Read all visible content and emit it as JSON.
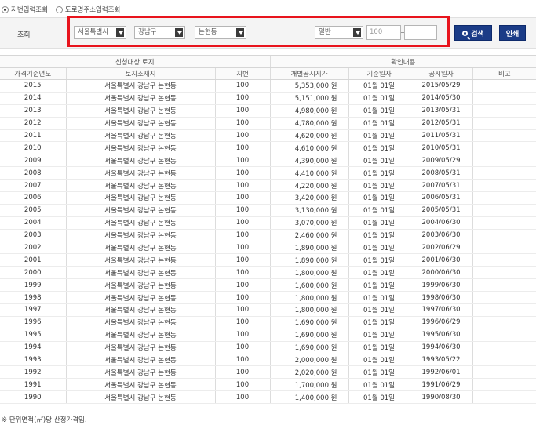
{
  "search_mode": {
    "options": [
      {
        "label": "지번입력조회",
        "checked": true
      },
      {
        "label": "도로명주소입력조회",
        "checked": false
      }
    ]
  },
  "search": {
    "label": "조회",
    "sido": "서울특별시",
    "sigungu": "강남구",
    "dong": "논현동",
    "land_type": "일반",
    "main_number": "100",
    "sub_number": "",
    "search_button": "검색",
    "print_button": "인쇄"
  },
  "table": {
    "group_headers": {
      "target_land": "신청대상 토지",
      "confirm": "확인내용"
    },
    "columns": [
      "가격기준년도",
      "토지소재지",
      "지번",
      "개별공시지가",
      "기준일자",
      "공시일자",
      "비고"
    ],
    "rows": [
      {
        "year": "2015",
        "location": "서울특별시 강남구 논현동",
        "lot": "100",
        "price": "5,353,000 원",
        "base_date": "01월 01일",
        "pub_date": "2015/05/29",
        "note": ""
      },
      {
        "year": "2014",
        "location": "서울특별시 강남구 논현동",
        "lot": "100",
        "price": "5,151,000 원",
        "base_date": "01월 01일",
        "pub_date": "2014/05/30",
        "note": ""
      },
      {
        "year": "2013",
        "location": "서울특별시 강남구 논현동",
        "lot": "100",
        "price": "4,980,000 원",
        "base_date": "01월 01일",
        "pub_date": "2013/05/31",
        "note": ""
      },
      {
        "year": "2012",
        "location": "서울특별시 강남구 논현동",
        "lot": "100",
        "price": "4,780,000 원",
        "base_date": "01월 01일",
        "pub_date": "2012/05/31",
        "note": ""
      },
      {
        "year": "2011",
        "location": "서울특별시 강남구 논현동",
        "lot": "100",
        "price": "4,620,000 원",
        "base_date": "01월 01일",
        "pub_date": "2011/05/31",
        "note": ""
      },
      {
        "year": "2010",
        "location": "서울특별시 강남구 논현동",
        "lot": "100",
        "price": "4,610,000 원",
        "base_date": "01월 01일",
        "pub_date": "2010/05/31",
        "note": ""
      },
      {
        "year": "2009",
        "location": "서울특별시 강남구 논현동",
        "lot": "100",
        "price": "4,390,000 원",
        "base_date": "01월 01일",
        "pub_date": "2009/05/29",
        "note": ""
      },
      {
        "year": "2008",
        "location": "서울특별시 강남구 논현동",
        "lot": "100",
        "price": "4,410,000 원",
        "base_date": "01월 01일",
        "pub_date": "2008/05/31",
        "note": ""
      },
      {
        "year": "2007",
        "location": "서울특별시 강남구 논현동",
        "lot": "100",
        "price": "4,220,000 원",
        "base_date": "01월 01일",
        "pub_date": "2007/05/31",
        "note": ""
      },
      {
        "year": "2006",
        "location": "서울특별시 강남구 논현동",
        "lot": "100",
        "price": "3,420,000 원",
        "base_date": "01월 01일",
        "pub_date": "2006/05/31",
        "note": ""
      },
      {
        "year": "2005",
        "location": "서울특별시 강남구 논현동",
        "lot": "100",
        "price": "3,130,000 원",
        "base_date": "01월 01일",
        "pub_date": "2005/05/31",
        "note": ""
      },
      {
        "year": "2004",
        "location": "서울특별시 강남구 논현동",
        "lot": "100",
        "price": "3,070,000 원",
        "base_date": "01월 01일",
        "pub_date": "2004/06/30",
        "note": ""
      },
      {
        "year": "2003",
        "location": "서울특별시 강남구 논현동",
        "lot": "100",
        "price": "2,460,000 원",
        "base_date": "01월 01일",
        "pub_date": "2003/06/30",
        "note": ""
      },
      {
        "year": "2002",
        "location": "서울특별시 강남구 논현동",
        "lot": "100",
        "price": "1,890,000 원",
        "base_date": "01월 01일",
        "pub_date": "2002/06/29",
        "note": ""
      },
      {
        "year": "2001",
        "location": "서울특별시 강남구 논현동",
        "lot": "100",
        "price": "1,890,000 원",
        "base_date": "01월 01일",
        "pub_date": "2001/06/30",
        "note": ""
      },
      {
        "year": "2000",
        "location": "서울특별시 강남구 논현동",
        "lot": "100",
        "price": "1,800,000 원",
        "base_date": "01월 01일",
        "pub_date": "2000/06/30",
        "note": ""
      },
      {
        "year": "1999",
        "location": "서울특별시 강남구 논현동",
        "lot": "100",
        "price": "1,600,000 원",
        "base_date": "01월 01일",
        "pub_date": "1999/06/30",
        "note": ""
      },
      {
        "year": "1998",
        "location": "서울특별시 강남구 논현동",
        "lot": "100",
        "price": "1,800,000 원",
        "base_date": "01월 01일",
        "pub_date": "1998/06/30",
        "note": ""
      },
      {
        "year": "1997",
        "location": "서울특별시 강남구 논현동",
        "lot": "100",
        "price": "1,800,000 원",
        "base_date": "01월 01일",
        "pub_date": "1997/06/30",
        "note": ""
      },
      {
        "year": "1996",
        "location": "서울특별시 강남구 논현동",
        "lot": "100",
        "price": "1,690,000 원",
        "base_date": "01월 01일",
        "pub_date": "1996/06/29",
        "note": ""
      },
      {
        "year": "1995",
        "location": "서울특별시 강남구 논현동",
        "lot": "100",
        "price": "1,690,000 원",
        "base_date": "01월 01일",
        "pub_date": "1995/06/30",
        "note": ""
      },
      {
        "year": "1994",
        "location": "서울특별시 강남구 논현동",
        "lot": "100",
        "price": "1,690,000 원",
        "base_date": "01월 01일",
        "pub_date": "1994/06/30",
        "note": ""
      },
      {
        "year": "1993",
        "location": "서울특별시 강남구 논현동",
        "lot": "100",
        "price": "2,000,000 원",
        "base_date": "01월 01일",
        "pub_date": "1993/05/22",
        "note": ""
      },
      {
        "year": "1992",
        "location": "서울특별시 강남구 논현동",
        "lot": "100",
        "price": "2,020,000 원",
        "base_date": "01월 01일",
        "pub_date": "1992/06/01",
        "note": ""
      },
      {
        "year": "1991",
        "location": "서울특별시 강남구 논현동",
        "lot": "100",
        "price": "1,700,000 원",
        "base_date": "01월 01일",
        "pub_date": "1991/06/29",
        "note": ""
      },
      {
        "year": "1990",
        "location": "서울특별시 강남구 논현동",
        "lot": "100",
        "price": "1,400,000 원",
        "base_date": "01월 01일",
        "pub_date": "1990/08/30",
        "note": ""
      }
    ]
  },
  "footnote": "※ 단위면적(㎡)당 산정가격임.",
  "colors": {
    "accent": "#1b3c87",
    "highlight_border": "#e8141d"
  }
}
